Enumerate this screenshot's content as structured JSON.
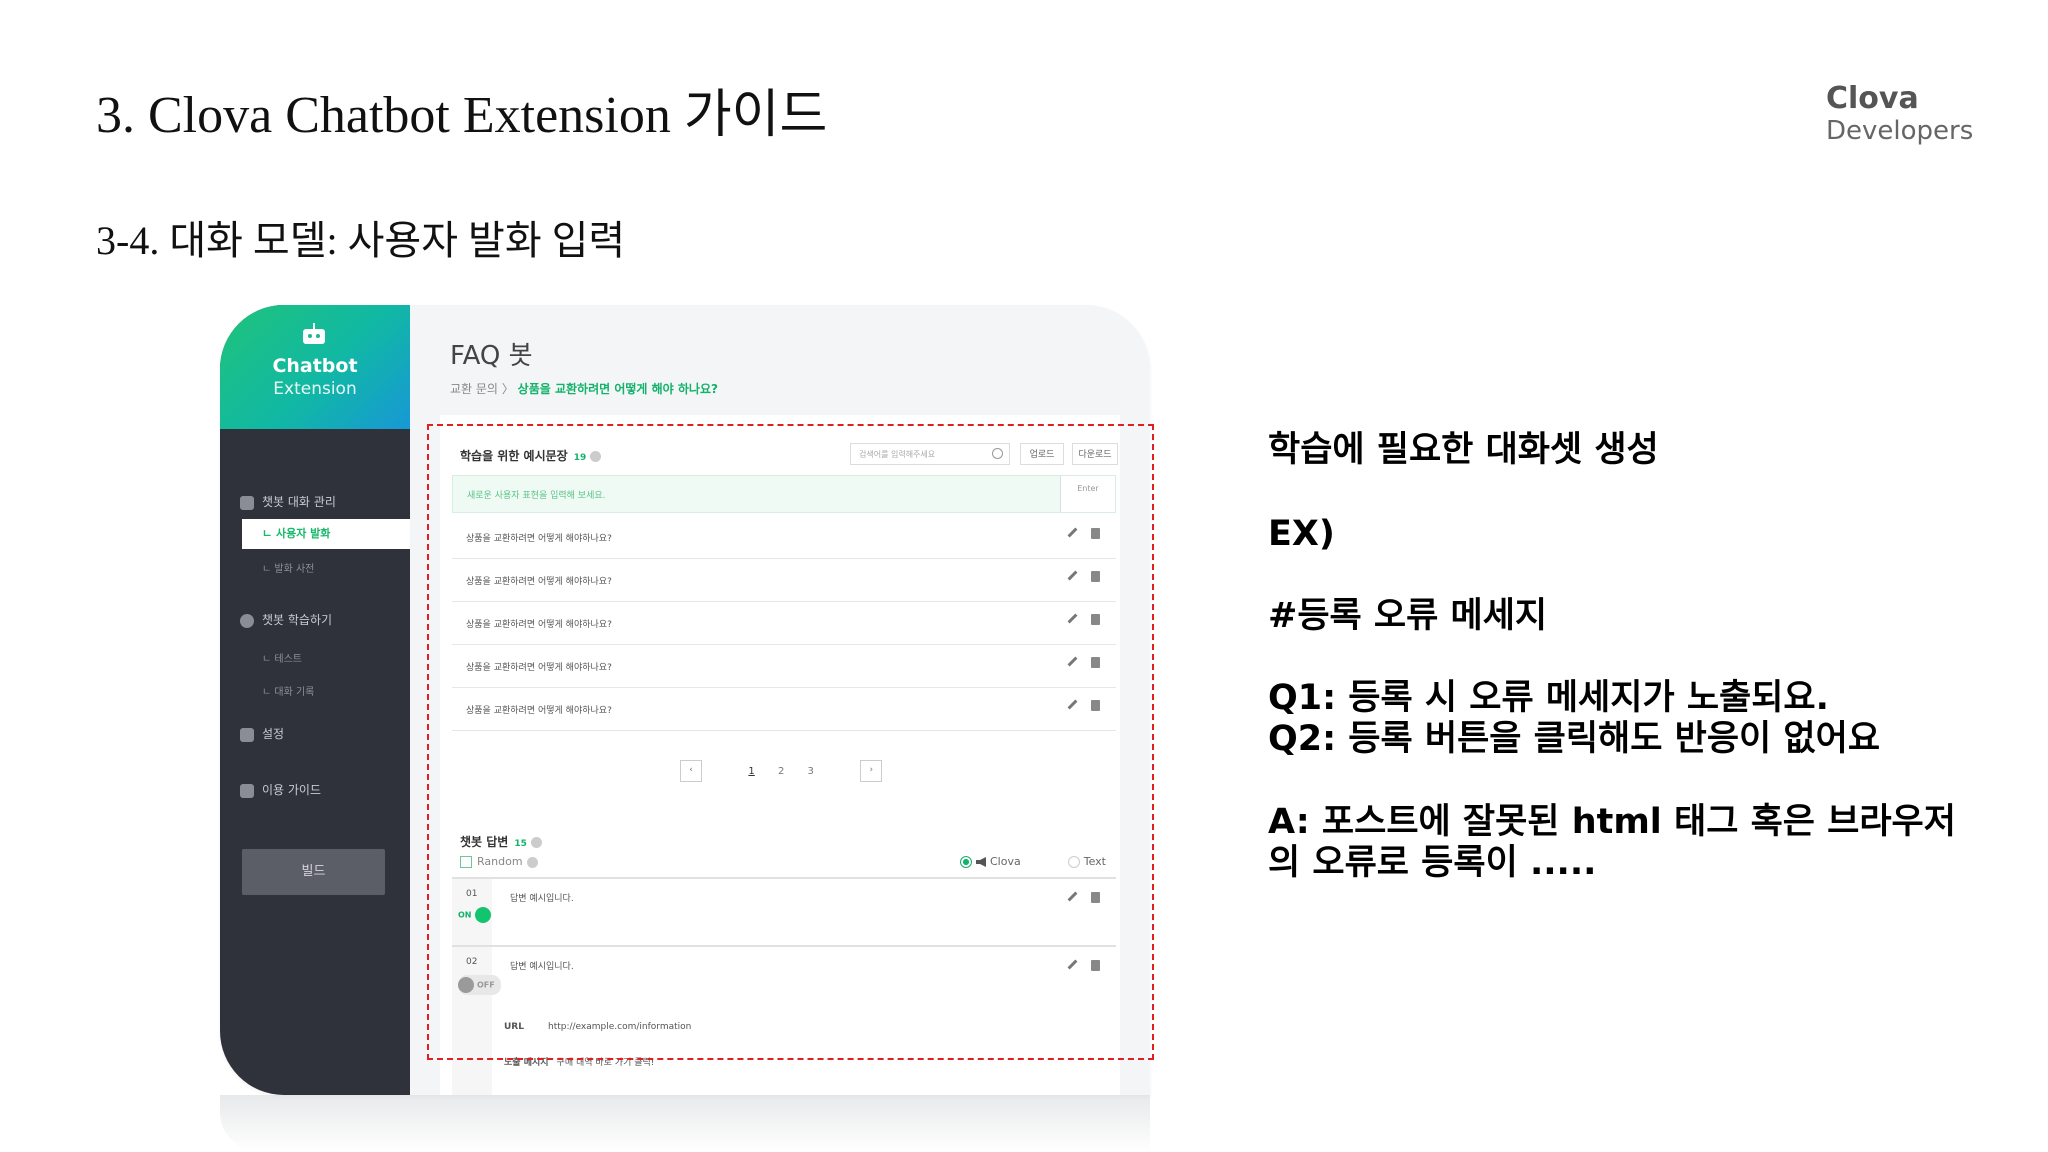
{
  "slide": {
    "title": "3. Clova Chatbot Extension 가이드",
    "subtitle": "3-4. 대화 모델: 사용자 발화 입력",
    "brand_name": "Clova",
    "brand_sub": "Developers"
  },
  "sidebar": {
    "title": "Chatbot",
    "subtitle": "Extension",
    "items": [
      {
        "label": "챗봇 대화 관리",
        "icon": "chat-icon"
      },
      {
        "label": "ㄴ 사용자 발화",
        "active": true
      },
      {
        "label": "ㄴ 발화 사전"
      },
      {
        "label": "챗봇 학습하기",
        "icon": "robot-face-icon"
      },
      {
        "label": "ㄴ 테스트"
      },
      {
        "label": "ㄴ 대화 기록"
      },
      {
        "label": "설정",
        "icon": "chart-icon"
      },
      {
        "label": "이용 가이드",
        "icon": "book-icon"
      }
    ],
    "build_label": "빌드"
  },
  "main": {
    "title": "FAQ 봇",
    "breadcrumb_parent": "교환 문의",
    "breadcrumb_sep": "〉",
    "breadcrumb_current": "상품을 교환하려면 어떻게 해야 하나요?",
    "examples": {
      "title": "학습을 위한 예시문장",
      "count": "19",
      "search_placeholder": "검색어를 입력해주세요",
      "upload_label": "업로드",
      "download_label": "다운로드",
      "new_placeholder": "새로운 사용자 표현을 입력해 보세요.",
      "enter_label": "Enter",
      "rows": [
        "상품을 교환하려면 어떻게 해야하나요?",
        "상품을 교환하려면 어떻게 해야하나요?",
        "상품을 교환하려면 어떻게 해야하나요?",
        "상품을 교환하려면 어떻게 해야하나요?",
        "상품을 교환하려면 어떻게 해야하나요?"
      ]
    },
    "pagination": {
      "prev": "‹",
      "pages": [
        "1",
        "2",
        "3"
      ],
      "next": "›"
    },
    "answers": {
      "title": "챗봇 답변",
      "count": "15",
      "random_label": "Random",
      "clova_label": "Clova",
      "text_label": "Text",
      "items": [
        {
          "num": "01",
          "text": "답변 예시입니다.",
          "toggle": "ON"
        },
        {
          "num": "02",
          "text": "답변 예시입니다.",
          "toggle": "OFF"
        }
      ],
      "url_label": "URL",
      "url_value": "http://example.com/information",
      "expose_label": "노출 메시지",
      "expose_value": "구매 내역 바로 가기 클릭!"
    }
  },
  "notes": {
    "line1": "학습에 필요한 대화셋 생성",
    "line2": "EX)",
    "line3": "#등록 오류 메세지",
    "line4": "Q1: 등록 시 오류 메세지가 노출되요.",
    "line5": "Q2: 등록 버튼을 클릭해도 반응이 없어요",
    "line6": "A: 포스트에 잘못된 html 태그 혹은 브라우저",
    "line7": "의 오류로 등록이 ....."
  },
  "colors": {
    "accent_green": "#13b26a",
    "sidebar_bg": "#2f323a",
    "highlight_border": "#e02020"
  }
}
